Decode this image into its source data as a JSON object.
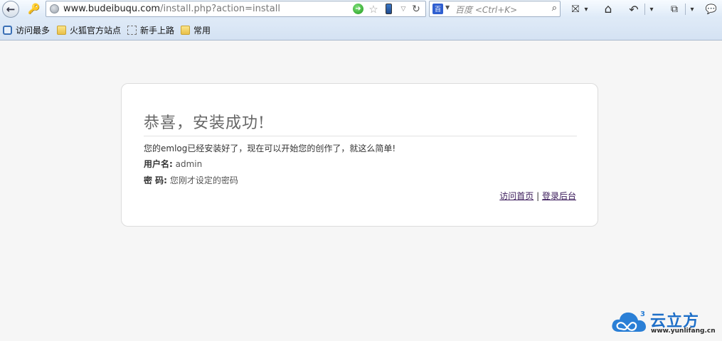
{
  "browser": {
    "url_host": "www.budeibuqu.com",
    "url_path": "/install.php?action=install",
    "search_engine_icon": "百",
    "search_placeholder": "百度 <Ctrl+K>",
    "icons": {
      "back": "←",
      "key": "🔑",
      "go": "➜",
      "star": "☆",
      "dropdown": "▽",
      "reload": "↻",
      "engine_dropdown": "▼",
      "magnifier": "⌕",
      "bookmark_menu": "⛝",
      "toolbar_dropdown": "▾",
      "home": "⌂",
      "undo": "↶",
      "crop": "⧉",
      "chat": "💬"
    }
  },
  "bookmarks": [
    {
      "label": "访问最多",
      "icon": "most-visited-icon"
    },
    {
      "label": "火狐官方站点",
      "icon": "folder-icon"
    },
    {
      "label": "新手上路",
      "icon": "dashed-page-icon"
    },
    {
      "label": "常用",
      "icon": "folder-icon"
    }
  ],
  "install": {
    "title": "恭喜，安装成功!",
    "message": "您的emlog已经安装好了，现在可以开始您的创作了，就这么简单!",
    "username_label": "用户名:",
    "username_value": "admin",
    "password_label": "密 码:",
    "password_value": "您刚才设定的密码",
    "link_home": "访问首页",
    "separator": "|",
    "link_admin": "登录后台"
  },
  "watermark": {
    "name": "云立方",
    "url": "www.yunlifang.cn",
    "superscript": "3"
  },
  "colors": {
    "page_bg": "#f6f6f6",
    "card_border": "#dcdcdc",
    "watermark_blue": "#1e6fc8",
    "link_color": "#3a1a5a"
  }
}
